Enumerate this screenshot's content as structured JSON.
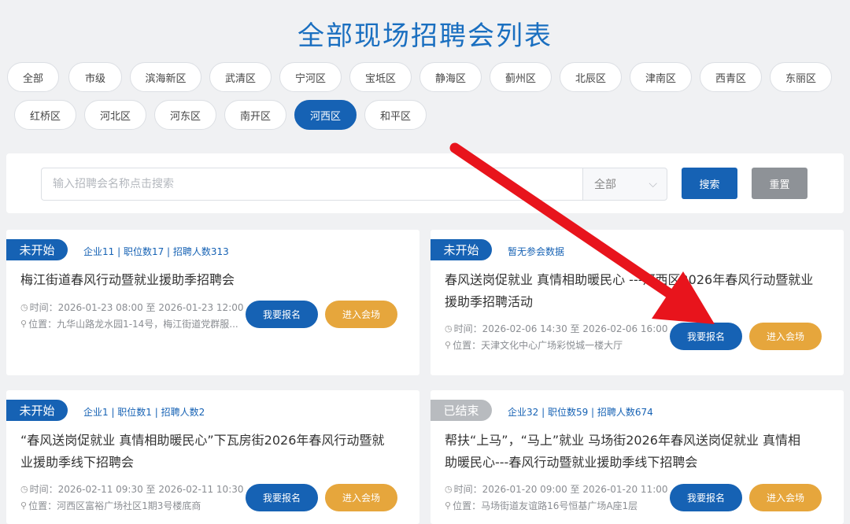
{
  "title": "全部现场招聘会列表",
  "districts": [
    {
      "label": "全部",
      "active": false
    },
    {
      "label": "市级",
      "active": false
    },
    {
      "label": "滨海新区",
      "active": false
    },
    {
      "label": "武清区",
      "active": false
    },
    {
      "label": "宁河区",
      "active": false
    },
    {
      "label": "宝坻区",
      "active": false
    },
    {
      "label": "静海区",
      "active": false
    },
    {
      "label": "蓟州区",
      "active": false
    },
    {
      "label": "北辰区",
      "active": false
    },
    {
      "label": "津南区",
      "active": false
    },
    {
      "label": "西青区",
      "active": false
    },
    {
      "label": "东丽区",
      "active": false
    },
    {
      "label": "红桥区",
      "active": false
    },
    {
      "label": "河北区",
      "active": false
    },
    {
      "label": "河东区",
      "active": false
    },
    {
      "label": "南开区",
      "active": false
    },
    {
      "label": "河西区",
      "active": true
    },
    {
      "label": "和平区",
      "active": false
    }
  ],
  "search": {
    "placeholder": "输入招聘会名称点击搜索",
    "select_value": "全部",
    "search_label": "搜索",
    "reset_label": "重置"
  },
  "cards": [
    {
      "status": "未开始",
      "stats": "企业11 | 职位数17 | 招聘人数313",
      "title_line1": "梅江街道春风行动暨就业援助季招聘会",
      "title_line2": "",
      "time": "时间：2026-01-23 08:00 至 2026-01-23 12:00",
      "location": "位置：九华山路龙水园1-14号，梅江街道党群服...",
      "signup_label": "我要报名",
      "enter_label": "进入会场"
    },
    {
      "status": "未开始",
      "stats": "暂无参会数据",
      "title_line1": "春风送岗促就业 真情相助暖民心 ---河西区2026年春风行动暨就业",
      "title_line2": "援助季招聘活动",
      "time": "时间：2026-02-06 14:30 至 2026-02-06 16:00",
      "location": "位置：天津文化中心广场彩悦城一楼大厅",
      "signup_label": "我要报名",
      "enter_label": "进入会场"
    },
    {
      "status": "未开始",
      "stats": "企业1 | 职位数1 | 招聘人数2",
      "title_line1": "“春风送岗促就业 真情相助暖民心”下瓦房街2026年春风行动暨就",
      "title_line2": "业援助季线下招聘会",
      "time": "时间：2026-02-11 09:30 至 2026-02-11 10:30",
      "location": "位置：河西区富裕广场社区1期3号楼底商",
      "signup_label": "我要报名",
      "enter_label": "进入会场"
    },
    {
      "status": "已结束",
      "stats": "企业32 | 职位数59 | 招聘人数674",
      "title_line1": "帮扶“上马”，“马上”就业 马场街2026年春风送岗促就业 真情相",
      "title_line2": "助暖民心---春风行动暨就业援助季线下招聘会",
      "time": "时间：2026-01-20 09:00 至 2026-01-20 11:00",
      "location": "位置：马场街道友谊路16号恒基广场A座1层",
      "signup_label": "我要报名",
      "enter_label": "进入会场"
    }
  ],
  "colors": {
    "primary": "#1662b4",
    "accent": "#e6a63c",
    "title": "#1a6fc0",
    "annotation_arrow": "#e8141c"
  }
}
